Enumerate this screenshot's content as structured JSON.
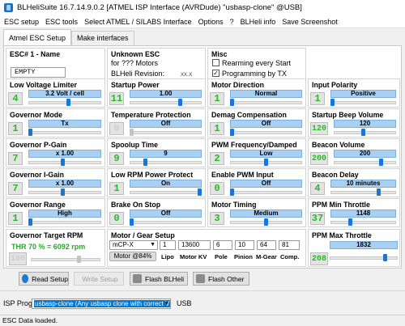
{
  "window": {
    "title": "BLHeliSuite 16.7.14.9.0.2  [ATMEL ISP Interface (AVRDude) \"usbasp-clone\" @USB]"
  },
  "menu": [
    "ESC setup",
    "ESC tools",
    "Select ATMEL / SILABS Interface",
    "Options",
    "?",
    "BLHeli info",
    "Save Screenshot"
  ],
  "tabs": [
    "Atmel ESC Setup",
    "Make interfaces"
  ],
  "esc": {
    "label": "ESC# 1 - Name",
    "name": "EMPTY"
  },
  "unknown_esc": {
    "title": "Unknown ESC",
    "for_text": "for  ???  Motors",
    "revision_label": "BLHeli Revision:",
    "revision_value": "xx.x"
  },
  "misc": {
    "title": "Misc",
    "options": [
      {
        "label": "Rearming every Start",
        "checked": false
      },
      {
        "label": "Programming by TX",
        "checked": true
      }
    ]
  },
  "params": [
    {
      "label": "Low Voltage Limiter",
      "num": "4",
      "value": "3.2 Volt / cell",
      "level": 0.55
    },
    {
      "label": "Startup Power",
      "num": "11",
      "value": "1.00",
      "level": 0.72
    },
    {
      "label": "Motor Direction",
      "num": "1",
      "value": "Normal",
      "level": 0.0
    },
    {
      "label": "Input Polarity",
      "num": "1",
      "value": "Positive",
      "level": 0.0
    },
    {
      "label": "Governor Mode",
      "num": "1",
      "value": "Tx",
      "level": 0.0
    },
    {
      "label": "Temperature Protection",
      "num": "0",
      "value": "Off",
      "level": 0.0,
      "grey": true
    },
    {
      "label": "Demag Compensation",
      "num": "1",
      "value": "Off",
      "level": 0.0
    },
    {
      "label": "Startup Beep Volume",
      "num": "120",
      "value": "120",
      "level": 0.47
    },
    {
      "label": "Governor P-Gain",
      "num": "7",
      "value": "x 1.00",
      "level": 0.47
    },
    {
      "label": "Spoolup Time",
      "num": "9",
      "value": "9",
      "level": 0.2
    },
    {
      "label": "PWM Frequency/Damped",
      "num": "2",
      "value": "Low",
      "level": 0.5
    },
    {
      "label": "Beacon Volume",
      "num": "200",
      "value": "200",
      "level": 0.78
    },
    {
      "label": "Governor I-Gain",
      "num": "7",
      "value": "x 1.00",
      "level": 0.47
    },
    {
      "label": "Low RPM Power Protect",
      "num": "1",
      "value": "On",
      "level": 1.0
    },
    {
      "label": "Enable PWM Input",
      "num": "0",
      "value": "Off",
      "level": 0.0
    },
    {
      "label": "Beacon Delay",
      "num": "4",
      "value": "10 minutes",
      "level": 0.75
    },
    {
      "label": "Governor Range",
      "num": "1",
      "value": "High",
      "level": 0.0
    },
    {
      "label": "Brake On Stop",
      "num": "0",
      "value": "Off",
      "level": 0.0
    },
    {
      "label": "Motor Timing",
      "num": "3",
      "value": "Medium",
      "level": 0.5
    },
    {
      "label": "PPM Min Throttle",
      "num": "37",
      "value": "1148",
      "level": 0.29
    }
  ],
  "governor_target": {
    "label": "Governor Target RPM",
    "text": "THR 70 % = 6092 rpm",
    "num": "180",
    "level": 0.7
  },
  "motor_gear": {
    "title": "Motor / Gear Setup",
    "model": "mCP-X",
    "fields": [
      {
        "label": "Lipo",
        "value": "1"
      },
      {
        "label": "Motor KV",
        "value": "13600"
      },
      {
        "label": "Pole",
        "value": "6"
      },
      {
        "label": "Pinion",
        "value": "10"
      },
      {
        "label": "M-Gear",
        "value": "64"
      },
      {
        "label": "Comp.",
        "value": "81"
      }
    ],
    "badge": "Motor @84%"
  },
  "ppm_max": {
    "label": "PPM Max Throttle",
    "num": "208",
    "value": "1832",
    "level": 0.83
  },
  "buttons": {
    "read": "Read Setup",
    "write": "Write Setup",
    "flash_blheli": "Flash BLHeli",
    "flash_other": "Flash Other"
  },
  "isp": {
    "label": "ISP Prog:",
    "selected": "usbasp-clone (Any usbasp clone with correct VID/PID)",
    "port": "USB"
  },
  "status": "ESC Data loaded.",
  "colors": {
    "accent": "#1877d6",
    "value_fill": "#a9d0f2",
    "value_digit": "#28b828"
  }
}
